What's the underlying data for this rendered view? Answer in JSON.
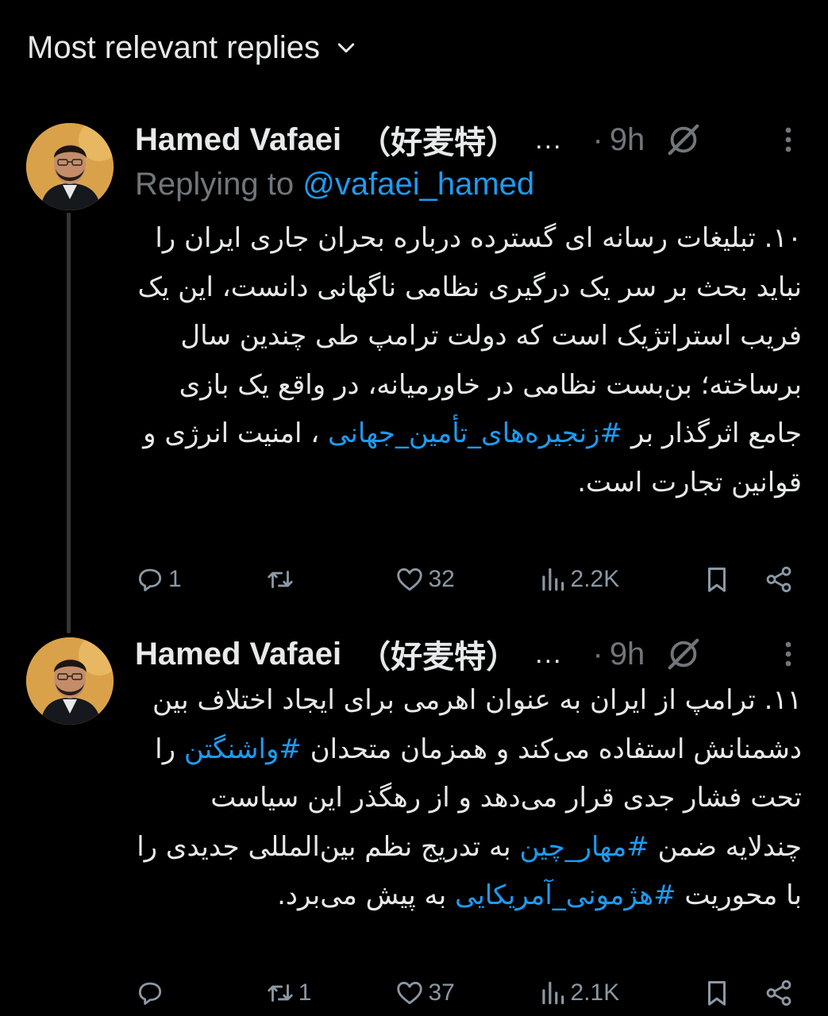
{
  "header": {
    "sort_label": "Most relevant replies"
  },
  "tweets": [
    {
      "author_name": "Hamed Vafaei",
      "author_cjk": "（好麦特）",
      "ellipsis": "...",
      "separator": "·",
      "time": "9h",
      "replying_prefix": "Replying to ",
      "replying_handle": "@vafaei_hamed",
      "text": {
        "p1": "۱۰. تبلیغات رسانه ای گسترده درباره بحران جاری ایران را نباید بحث بر سر یک درگیری نظامی ناگهانی دانست، این یک فریب استراتژیک است که دولت ترامپ طی چندین سال برساخته؛ بن‌بست نظامی در خاورمیانه، در واقع یک بازی جامع اثرگذار بر ",
        "h1": "#زنجیره‌های_تأمین_جهانی",
        "p2": " ، امنیت انرژی و قوانین تجارت است."
      },
      "stats": {
        "replies": "1",
        "reposts": "",
        "likes": "32",
        "views": "2.2K"
      }
    },
    {
      "author_name": "Hamed Vafaei",
      "author_cjk": "（好麦特）",
      "ellipsis": "...",
      "separator": "·",
      "time": "9h",
      "text": {
        "p1": "۱۱. ترامپ از ایران به عنوان اهرمی برای ایجاد اختلاف بین دشمنانش استفاده می‌کند و همزمان متحدان ",
        "h1": "#واشنگتن",
        "p2": " را تحت فشار جدی قرار می‌دهد و از رهگذر این سیاست چندلایه ضمن ",
        "h2": "#مهار_چین",
        "p3": " به تدریج نظم بین‌المللی جدیدی را با محوریت ",
        "h3": "#هژمونی_آمریکایی",
        "p4": " به پیش می‌برد."
      },
      "stats": {
        "replies": "",
        "reposts": "1",
        "likes": "37",
        "views": "2.1K"
      }
    }
  ],
  "icons": {
    "sort": "chevron-down-icon",
    "grok": "grok-icon",
    "more": "more-vertical-icon",
    "reply": "reply-icon",
    "repost": "repost-icon",
    "like": "heart-icon",
    "views": "views-icon",
    "bookmark": "bookmark-icon",
    "share": "share-icon"
  },
  "colors": {
    "background": "#000000",
    "text": "#e7e9ea",
    "muted": "#71767b",
    "link": "#1d9bf0",
    "icon": "#8b98a5",
    "thread_line": "#333639"
  }
}
